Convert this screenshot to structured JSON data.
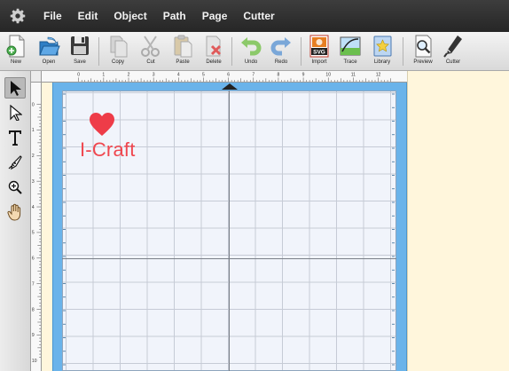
{
  "menu": {
    "items": [
      "File",
      "Edit",
      "Object",
      "Path",
      "Page",
      "Cutter"
    ]
  },
  "toolbar": {
    "buttons": [
      {
        "label": "New",
        "icon": "new-document-icon"
      },
      {
        "label": "Open",
        "icon": "open-folder-icon"
      },
      {
        "label": "Save",
        "icon": "save-floppy-icon"
      },
      {
        "label": "Copy",
        "icon": "copy-icon"
      },
      {
        "label": "Cut",
        "icon": "scissors-icon"
      },
      {
        "label": "Paste",
        "icon": "paste-icon"
      },
      {
        "label": "Delete",
        "icon": "delete-icon"
      },
      {
        "label": "Undo",
        "icon": "undo-icon"
      },
      {
        "label": "Redo",
        "icon": "redo-icon"
      },
      {
        "label": "Import",
        "icon": "svg-import-icon"
      },
      {
        "label": "Trace",
        "icon": "trace-icon"
      },
      {
        "label": "Library",
        "icon": "library-star-icon"
      },
      {
        "label": "Preview",
        "icon": "preview-magnifier-icon"
      },
      {
        "label": "Cutter",
        "icon": "cutter-blade-icon"
      }
    ]
  },
  "tools": [
    {
      "name": "select-arrow-icon",
      "selected": true
    },
    {
      "name": "node-select-icon",
      "selected": false
    },
    {
      "name": "text-tool-icon",
      "selected": false
    },
    {
      "name": "pen-tool-icon",
      "selected": false
    },
    {
      "name": "zoom-tool-icon",
      "selected": false
    },
    {
      "name": "hand-pan-icon",
      "selected": false
    }
  ],
  "ruler": {
    "horizontal_labels": [
      "0",
      "1",
      "2",
      "3",
      "4",
      "5",
      "6",
      "7",
      "8",
      "9",
      "10",
      "11",
      "12"
    ],
    "vertical_labels": [
      "0",
      "1",
      "2",
      "3",
      "4",
      "5",
      "6",
      "7",
      "8",
      "9",
      "10"
    ]
  },
  "canvas": {
    "text_object": "I-Craft",
    "shape_object": "heart",
    "text_color": "#f0474f",
    "heart_color": "#ee3c48",
    "mat_color": "#6ab3ea"
  }
}
